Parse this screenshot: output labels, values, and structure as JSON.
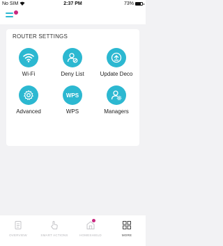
{
  "status": {
    "carrier": "No SIM",
    "time": "2:37 PM",
    "battery": "73%"
  },
  "icons": {
    "menu": "hamburger-menu-icon",
    "notification": "notification-dot-icon"
  },
  "colors": {
    "accent": "#2cb8d1",
    "badge": "#c8287f",
    "background": "#f2f2f4"
  },
  "router_settings": {
    "title": "ROUTER SETTINGS",
    "items": [
      {
        "label": "Wi-Fi",
        "icon": "wifi-icon"
      },
      {
        "label": "Deny List",
        "icon": "user-block-icon"
      },
      {
        "label": "Update Deco",
        "icon": "update-icon"
      },
      {
        "label": "Advanced",
        "icon": "gear-icon"
      },
      {
        "label": "WPS",
        "icon": "wps-icon",
        "icon_text": "WPS"
      },
      {
        "label": "Managers",
        "icon": "user-gear-icon"
      }
    ]
  },
  "bottom_nav": {
    "items": [
      {
        "label": "OVERVIEW",
        "icon": "overview-icon",
        "active": false
      },
      {
        "label": "SMART ACTIONS",
        "icon": "smart-actions-icon",
        "active": false
      },
      {
        "label": "HOMESHIELD",
        "icon": "homeshield-icon",
        "active": false,
        "badge": true
      },
      {
        "label": "MORE",
        "icon": "more-grid-icon",
        "active": true
      }
    ]
  }
}
